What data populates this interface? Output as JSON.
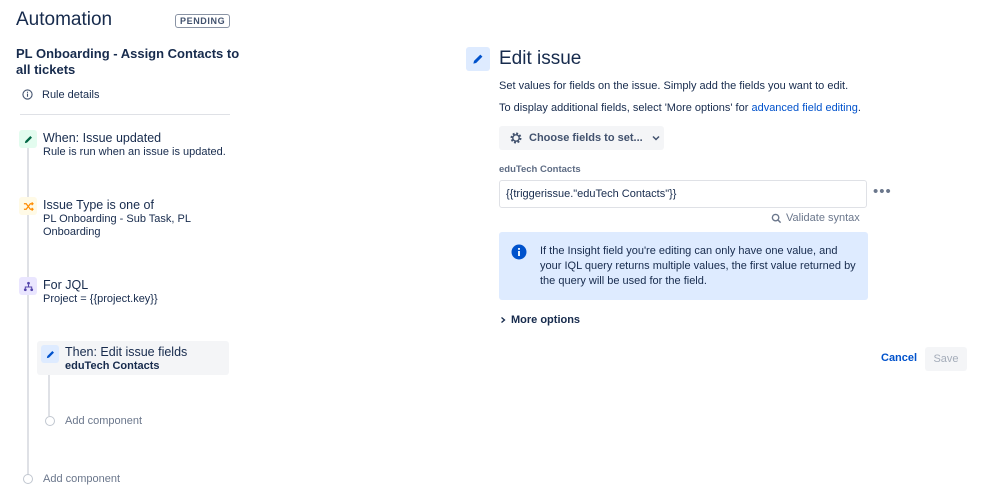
{
  "app": {
    "title": "Automation",
    "status_badge": "PENDING"
  },
  "rule": {
    "name": "PL Onboarding - Assign Contacts to all tickets",
    "details_label": "Rule details"
  },
  "flow": {
    "trigger": {
      "title": "When: Issue updated",
      "subtitle": "Rule is run when an issue is updated."
    },
    "condition": {
      "title": "Issue Type is one of",
      "subtitle": "PL Onboarding - Sub Task, PL Onboarding"
    },
    "branch": {
      "title": "For JQL",
      "subtitle": "Project = {{project.key}}"
    },
    "action": {
      "title": "Then: Edit issue fields",
      "subtitle": "eduTech Contacts"
    },
    "add_component_nested": "Add component",
    "add_component_root": "Add component"
  },
  "panel": {
    "title": "Edit issue",
    "desc1": "Set values for fields on the issue. Simply add the fields you want to edit.",
    "desc2": "To display additional fields, select 'More options' for ",
    "desc2_link": "advanced field editing",
    "desc2_end": ".",
    "choose_button": "Choose fields to set...",
    "field_label": "eduTech Contacts",
    "field_value": "{{triggerissue.\"eduTech Contacts\"}}",
    "field_more": "•••",
    "validate": "Validate syntax",
    "info": "If the Insight field you're editing can only have one value, and your IQL query returns multiple values, the first value returned by the query will be used for the field.",
    "more_options": "More options",
    "cancel": "Cancel",
    "save": "Save"
  },
  "colors": {
    "trigger_icon_bg": "#e3fcef",
    "condition_icon_bg": "#fffae6",
    "branch_icon_bg": "#eae6ff",
    "action_icon_bg": "#deebff",
    "link": "#0052cc"
  }
}
